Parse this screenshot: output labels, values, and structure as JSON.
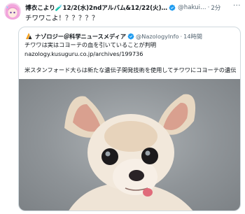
{
  "tweet": {
    "display_name": "博衣こより🧪12/2(水)2ndアルバム&12/22(火)…",
    "handle": "@hakui…",
    "separator": "·",
    "time": "2分",
    "more": "···",
    "text": "チワワこよ！？？？？？"
  },
  "quote": {
    "name": "ナゾロジー＠科学ニュースメディア",
    "handle": "@NazologyInfo",
    "separator": "·",
    "time": "14時間",
    "line1": "チワワは実はコヨーテの血を引いていることが判明",
    "line2": "nazology.kusuguru.co.jp/archives/199736",
    "line3": "米スタンフォード大らは新たな遺伝子開発技術を使用してチワワにコヨーテの遺伝子が入り込んでいることを明らかにしました。小さいのに意…"
  },
  "colors": {
    "text": "#0f1419",
    "secondary": "#536471",
    "verified": "#1d9bf0",
    "border": "#cfd9de"
  },
  "icons": {
    "verified": "verified-badge-icon",
    "more": "more-icon"
  }
}
